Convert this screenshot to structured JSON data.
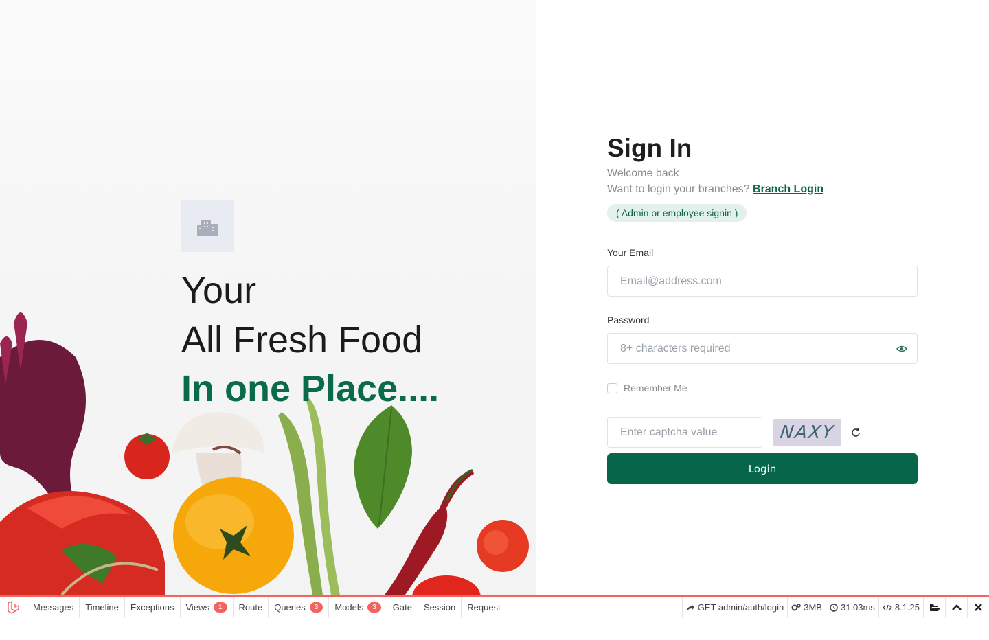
{
  "hero": {
    "line1": "Your",
    "line2": "All Fresh Food",
    "line3": "In one Place...."
  },
  "form": {
    "title": "Sign In",
    "welcome": "Welcome back",
    "branch_prompt": "Want to login your branches?",
    "branch_link": "Branch Login",
    "pill": "( Admin or employee signin )",
    "email_label": "Your Email",
    "email_placeholder": "Email@address.com",
    "password_label": "Password",
    "password_placeholder": "8+ characters required",
    "remember_label": "Remember Me",
    "captcha_placeholder": "Enter captcha value",
    "captcha_text": "NAXY",
    "login_label": "Login"
  },
  "debugbar": {
    "tabs": [
      {
        "label": "Messages",
        "badge": ""
      },
      {
        "label": "Timeline",
        "badge": ""
      },
      {
        "label": "Exceptions",
        "badge": ""
      },
      {
        "label": "Views",
        "badge": "1"
      },
      {
        "label": "Route",
        "badge": ""
      },
      {
        "label": "Queries",
        "badge": "3"
      },
      {
        "label": "Models",
        "badge": "3"
      },
      {
        "label": "Gate",
        "badge": ""
      },
      {
        "label": "Session",
        "badge": ""
      },
      {
        "label": "Request",
        "badge": ""
      }
    ],
    "request": "GET admin/auth/login",
    "memory": "3MB",
    "time": "31.03ms",
    "php_version": "8.1.25"
  },
  "colors": {
    "brand_green": "#076649",
    "debug_red": "#f4645f"
  }
}
